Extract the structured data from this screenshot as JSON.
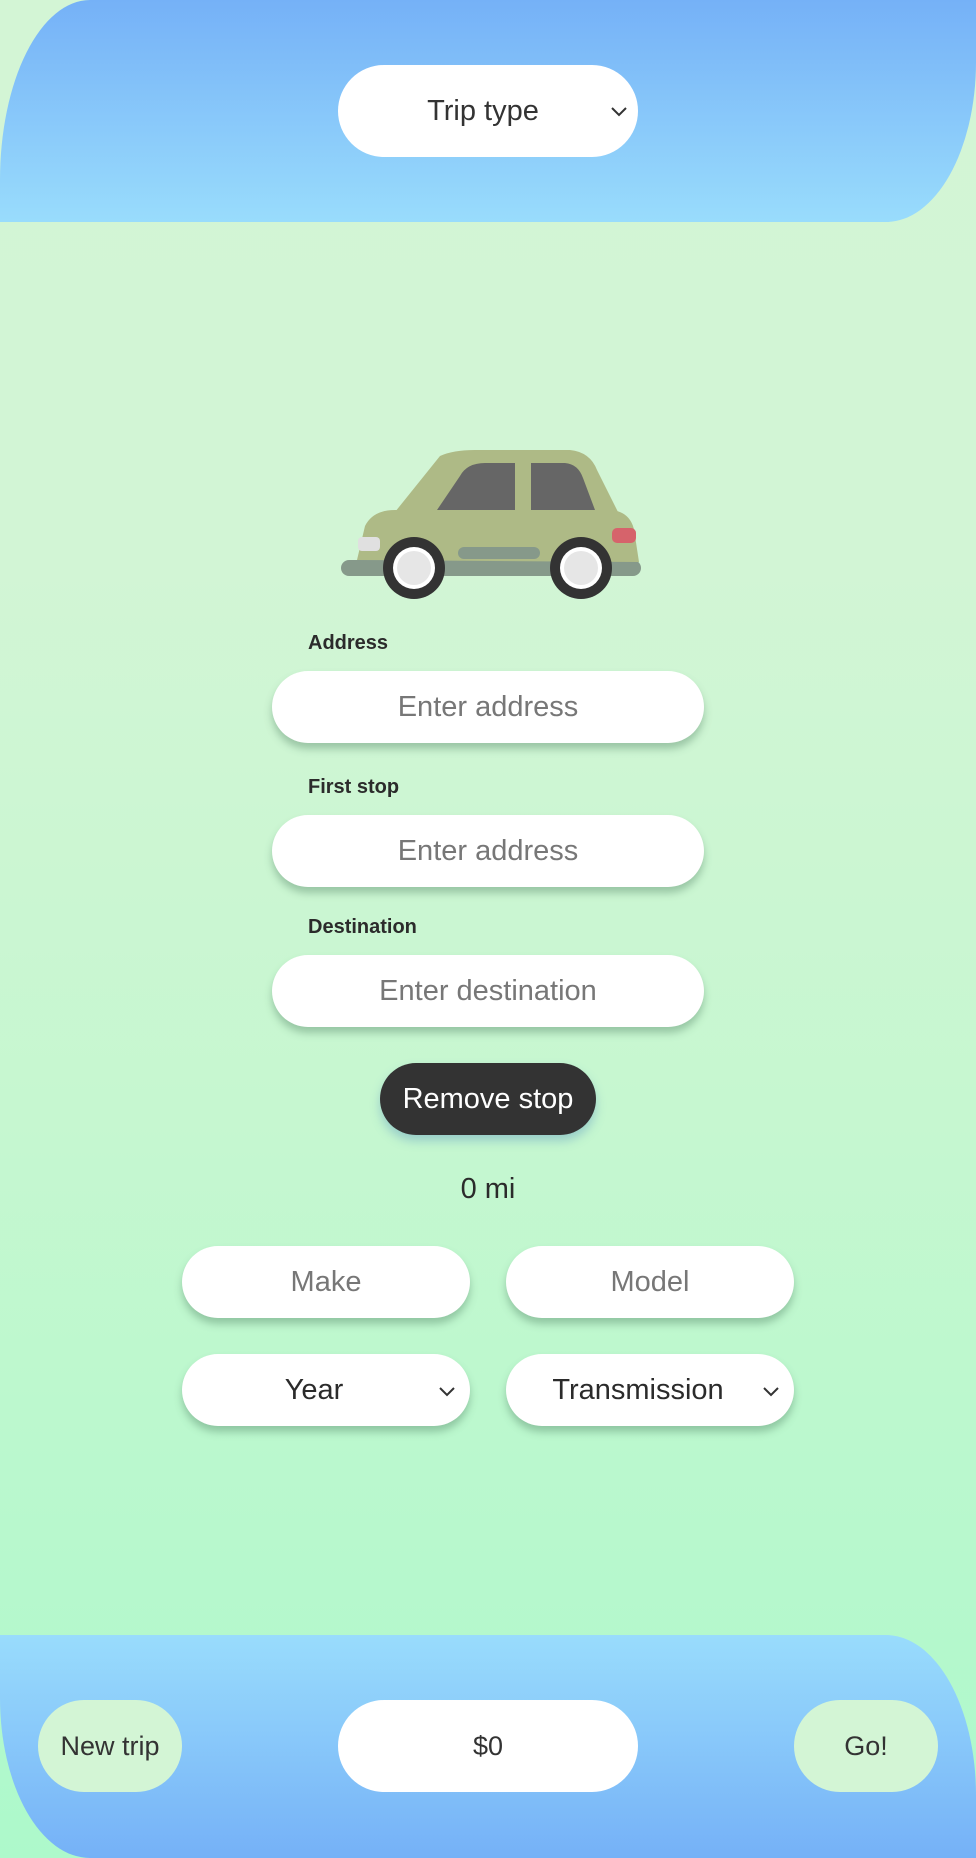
{
  "header": {
    "trip_type": {
      "selected": "Trip type",
      "chevron_icon": "chevron-down-icon"
    }
  },
  "illustration": {
    "icon": "car-icon",
    "colors": {
      "body": "#aeba86",
      "window": "#666666",
      "bumper": "#86998a",
      "tire": "#333333",
      "hubcap": "#e6e6e6",
      "headlight": "#e0e0e0",
      "taillight": "#d6636b"
    }
  },
  "form": {
    "address": {
      "label": "Address",
      "value": "",
      "placeholder": "Enter address"
    },
    "first_stop": {
      "label": "First stop",
      "value": "",
      "placeholder": "Enter address"
    },
    "destination": {
      "label": "Destination",
      "value": "",
      "placeholder": "Enter destination"
    },
    "remove_stop_label": "Remove stop",
    "distance": "0 mi",
    "vehicle": {
      "make": {
        "value": "",
        "placeholder": "Make"
      },
      "model": {
        "value": "",
        "placeholder": "Model"
      },
      "year": {
        "selected": "Year"
      },
      "transmission": {
        "selected": "Transmission"
      }
    }
  },
  "footer": {
    "new_trip_label": "New trip",
    "total_cost": "$0",
    "go_label": "Go!"
  },
  "colors": {
    "bar_gradient_light": "#99dcfc",
    "bar_gradient_dark": "#75b1f7",
    "background_top": "#d3f5d5",
    "background_bottom": "#adf9cb",
    "accent_button": "#d3f5d5",
    "dark_button": "#333333"
  }
}
